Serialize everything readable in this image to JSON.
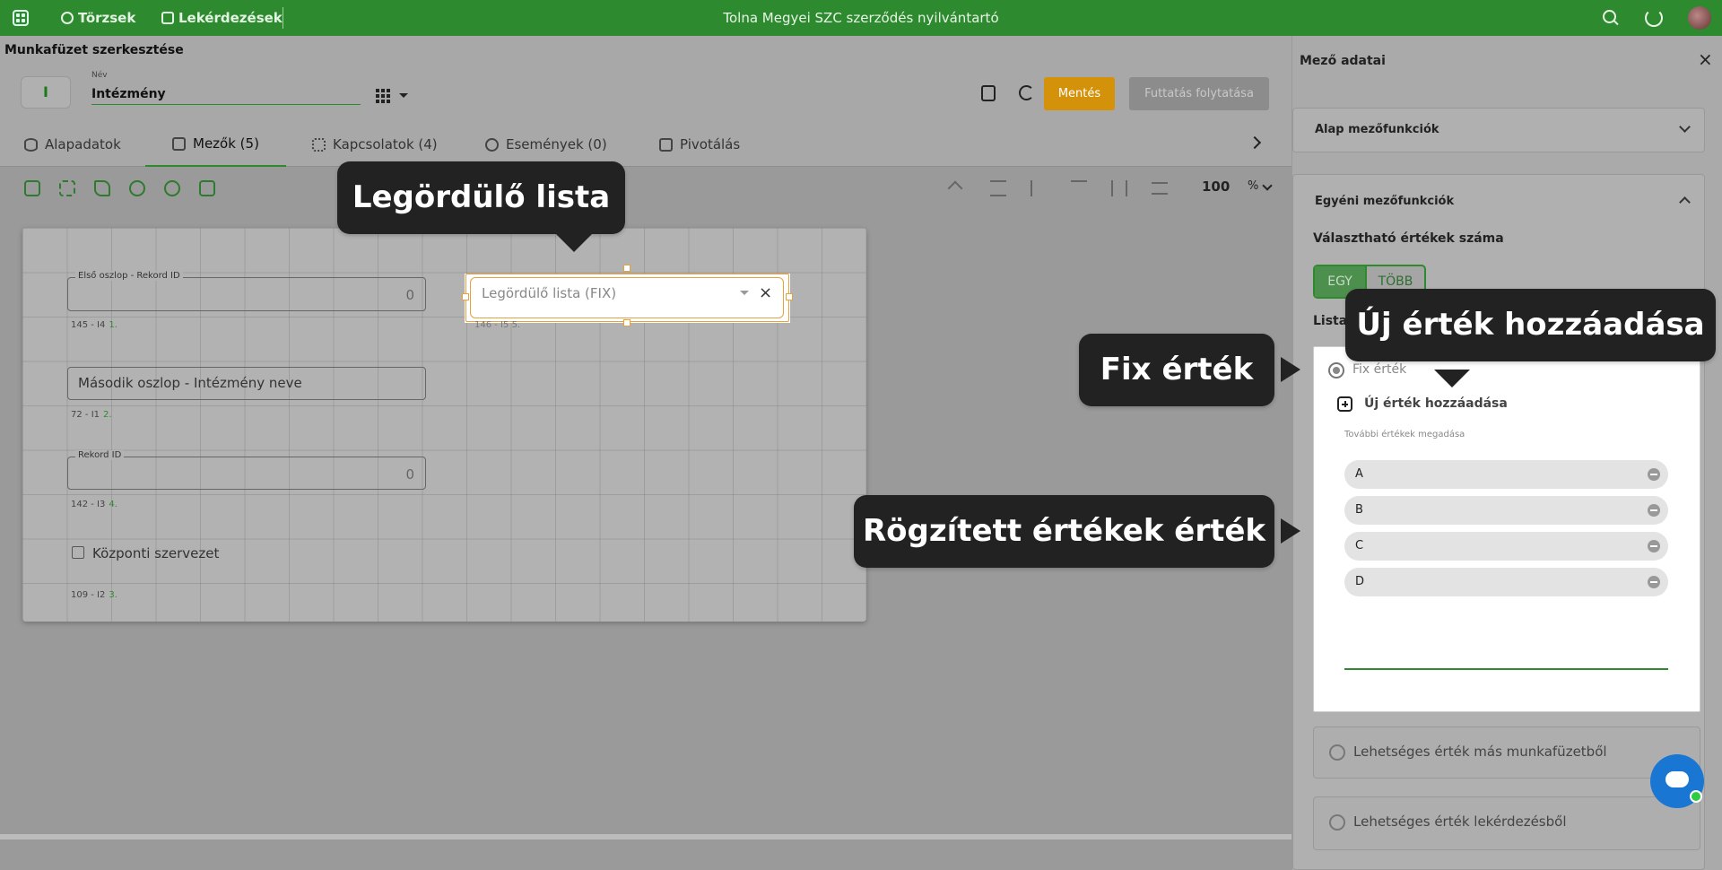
{
  "app": {
    "title": "Tolna Megyei SZC szerződés nyilvántartó",
    "nav": [
      "Törzsek",
      "Lekérdezések"
    ]
  },
  "page": {
    "title": "Munkafüzet szerkesztése",
    "icon_letter": "I",
    "name_label": "Név",
    "name_value": "Intézmény",
    "save_label": "Mentés",
    "run_label": "Futtatás folytatása"
  },
  "tabs": [
    {
      "label": "Alapadatok",
      "icon": "database-icon"
    },
    {
      "label": "Mezők (5)",
      "icon": "fields-icon",
      "active": true
    },
    {
      "label": "Kapcsolatok (4)",
      "icon": "relations-icon"
    },
    {
      "label": "Események (0)",
      "icon": "events-icon"
    },
    {
      "label": "Pivotálás",
      "icon": "pivot-icon"
    }
  ],
  "toolbar": {
    "zoom": "100",
    "zoom_unit": "%"
  },
  "canvas": {
    "fields": [
      {
        "label": "Első oszlop - Rekord ID",
        "value": "0",
        "meta": "145 - I4",
        "index": "1."
      },
      {
        "text": "Második oszlop - Intézmény neve",
        "meta": "72 - I1",
        "index": "2."
      },
      {
        "label": "Rekord ID",
        "value": "0",
        "meta": "142 - I3",
        "index": "4."
      },
      {
        "checkbox_label": "Központi szervezet",
        "meta": "109 - I2",
        "index": "3."
      }
    ],
    "dropdown": {
      "placeholder": "Legördülő lista (FIX)",
      "close": "×",
      "meta": "146 - I5",
      "index": "5."
    }
  },
  "panel": {
    "title": "Mező adatai",
    "close": "×",
    "section_basic": "Alap mezőfunkciók",
    "section_custom": "Egyéni mezőfunkciók",
    "selectable_count_label": "Választható értékek száma",
    "seg_one": "EGY",
    "seg_many": "TÖBB",
    "list_label": "Lista",
    "fix_label": "Fix érték",
    "add_new": "Új érték hozzáadása",
    "hint": "További értékek megadása",
    "values": [
      "A",
      "B",
      "C",
      "D"
    ],
    "other_wb": "Lehetséges érték más munkafüzetből",
    "other_query": "Lehetséges érték lekérdezésből"
  },
  "callouts": {
    "dropdown": "Legördülő lista",
    "fix": "Fix érték",
    "add": "Új érték hozzáadása",
    "fixed_values": "Rögzített értékek érték"
  },
  "colors": {
    "topbar": "#2e8a2e",
    "save": "#d4920a",
    "callout": "#222222",
    "selection": "#e6a23c"
  }
}
